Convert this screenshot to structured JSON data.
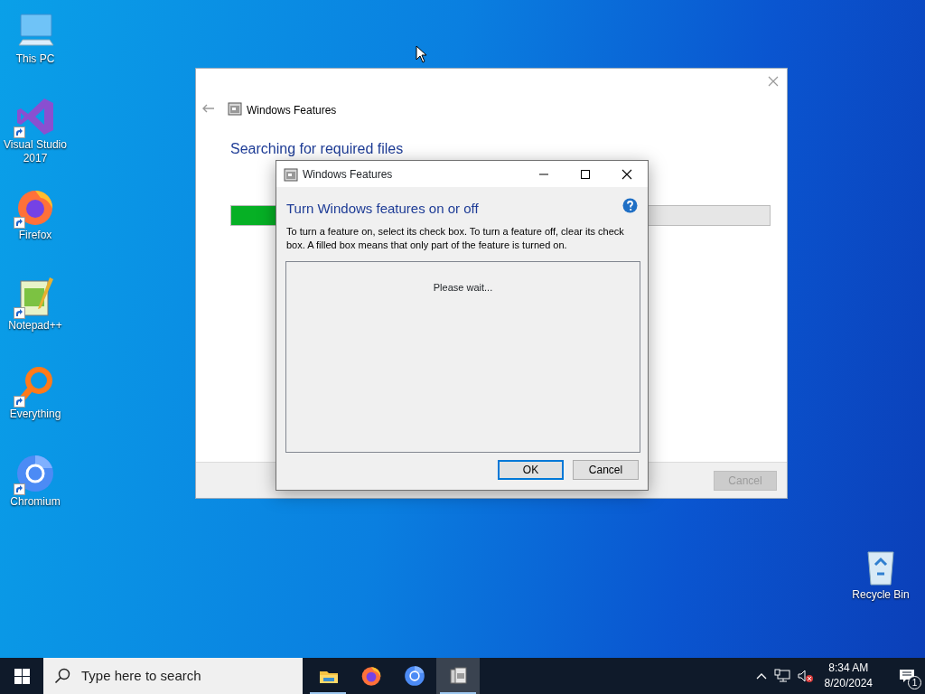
{
  "desktop_icons": [
    {
      "kind": "computer",
      "label": "This PC",
      "shortcut": false
    },
    {
      "kind": "vs",
      "label": "Visual Studio 2017",
      "shortcut": true
    },
    {
      "kind": "firefox",
      "label": "Firefox",
      "shortcut": true
    },
    {
      "kind": "notepad",
      "label": "Notepad++",
      "shortcut": true
    },
    {
      "kind": "everything",
      "label": "Everything",
      "shortcut": true
    },
    {
      "kind": "chromium",
      "label": "Chromium",
      "shortcut": true
    },
    {
      "kind": "recycle",
      "label": "Recycle Bin",
      "shortcut": false
    }
  ],
  "back_window": {
    "title": "Windows Features",
    "heading": "Searching for required files",
    "progress": {
      "level": 0.1
    },
    "cancel_button": {
      "label": "Cancel",
      "disabled": true
    }
  },
  "dialog": {
    "title": "Windows Features",
    "heading": "Turn Windows features on or off",
    "description": "To turn a feature on, select its check box. To turn a feature off, clear its check box. A filled box means that only part of the feature is turned on.",
    "list_message": "Please wait...",
    "buttons": [
      {
        "label": "OK",
        "default": true
      },
      {
        "label": "Cancel",
        "default": false
      }
    ]
  },
  "taskbar": {
    "search": {
      "placeholder": "Type here to search"
    },
    "apps": [
      {
        "kind": "explorer",
        "running": true,
        "selected": false
      },
      {
        "kind": "firefox",
        "running": false,
        "selected": false
      },
      {
        "kind": "chromium",
        "running": false,
        "selected": false
      },
      {
        "kind": "features",
        "running": true,
        "selected": true
      }
    ],
    "time": "8:34 AM",
    "date": "8/20/2024",
    "notifications": "1"
  }
}
